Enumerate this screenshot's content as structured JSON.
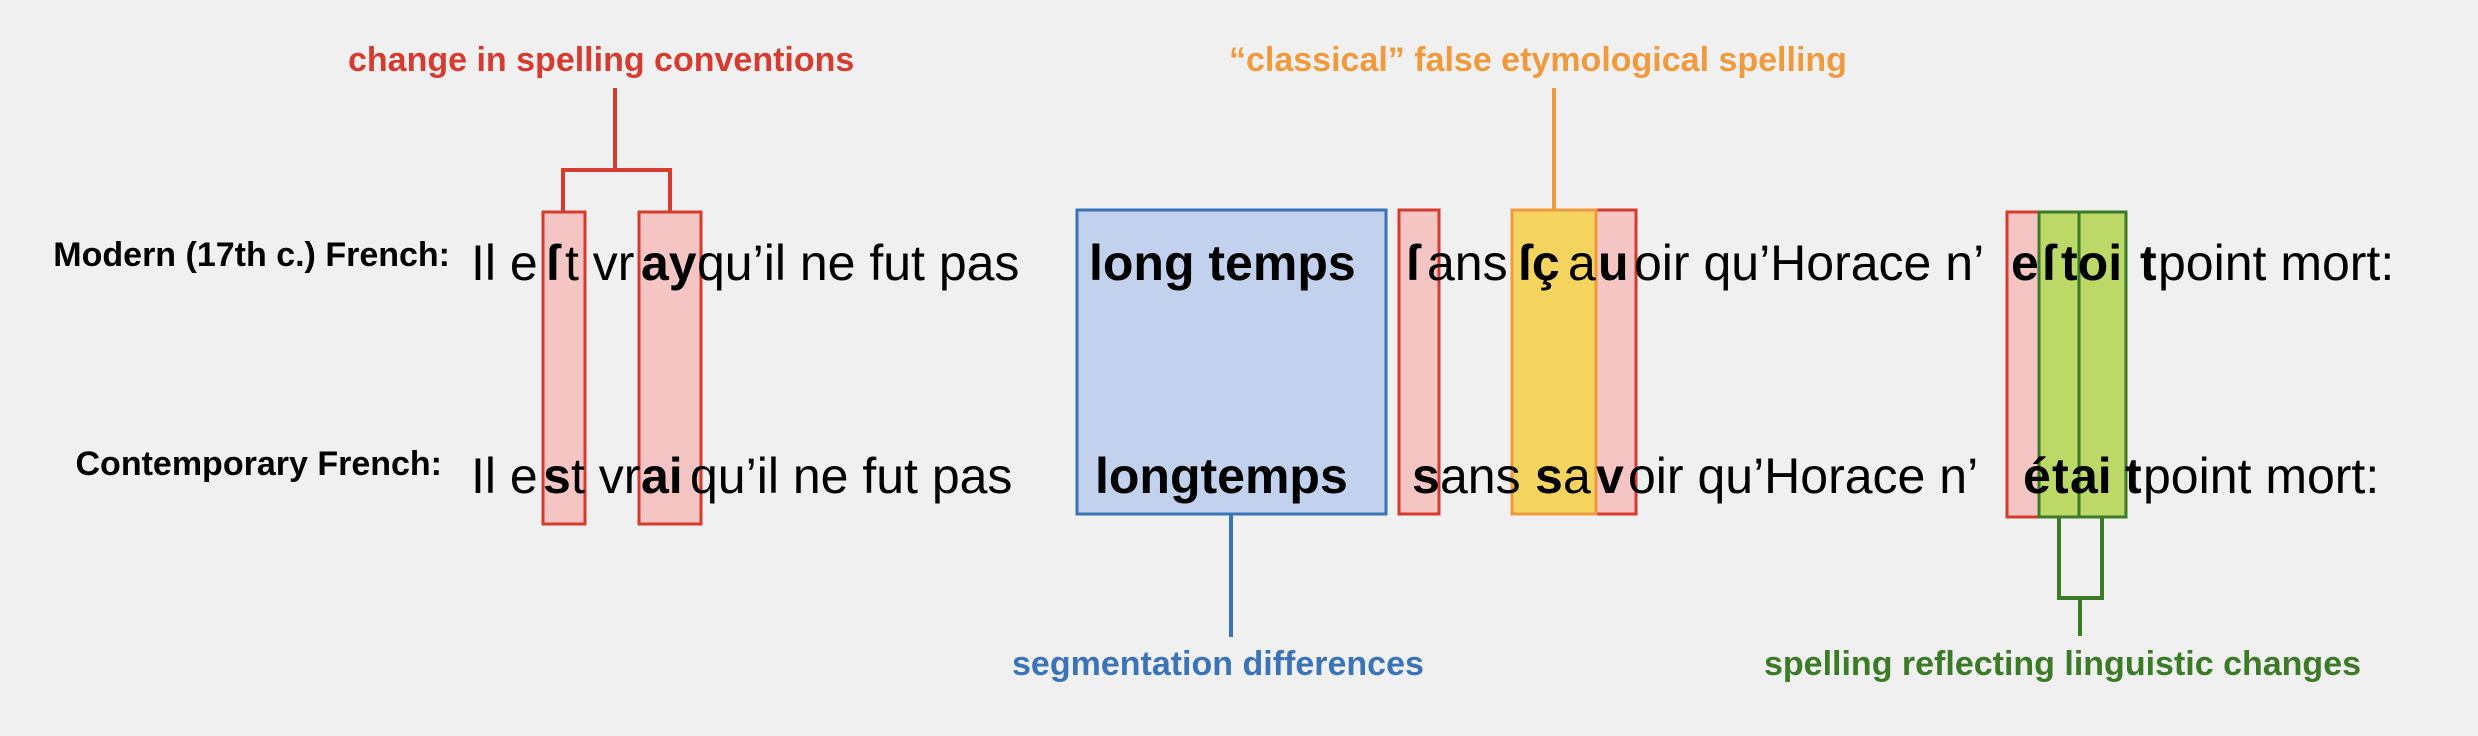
{
  "colors": {
    "background": "#f0f0f0",
    "red_stroke": "#d63b2f",
    "red_fill": "#f4c5c3",
    "blue_stroke": "#3a73b7",
    "blue_fill": "#c2d1ee",
    "orange_stroke": "#f09a3e",
    "orange_fill": "#f5d35f",
    "green_stroke": "#3b7a26",
    "green_fill": "#bcd867"
  },
  "categories": {
    "spelling_conventions": "change in spelling conventions",
    "false_etymology": "“classical” false etymological spelling",
    "segmentation": "segmentation differences",
    "linguistic_changes": "spelling reflecting linguistic changes"
  },
  "rows": {
    "modern": {
      "label": "Modern (17th c.) French:",
      "tokens": [
        "Il e",
        "ſ",
        "t vr",
        "ay",
        " qu’il ne fut pas",
        "long temps",
        "ſ",
        "ans ",
        "ſç",
        "a",
        "u",
        "oir qu’Horace n’",
        "e",
        "ſ",
        "toi",
        "t",
        " point mort:"
      ]
    },
    "contemporary": {
      "label": "Contemporary French:",
      "tokens": [
        "Il e",
        "s",
        "t vr",
        "ai",
        " qu’il ne fut pas",
        "longtemps",
        "s",
        "ans ",
        "s",
        "a",
        "v",
        "oir qu’Horace  n’",
        "é",
        "t",
        "ai",
        "t",
        " point mort:"
      ]
    }
  }
}
